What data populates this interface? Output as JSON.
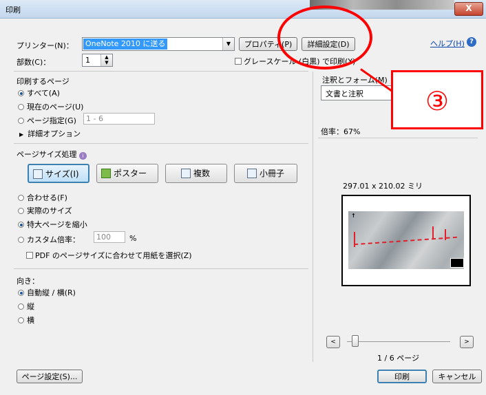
{
  "window": {
    "title": "印刷",
    "close_label": "X"
  },
  "printer": {
    "label": "プリンター(N)：",
    "selected": "OneNote 2010 に送る",
    "properties_button": "プロパティ(P)",
    "advanced_button": "詳細設定(D)",
    "help_link": "ヘルプ(H)"
  },
  "copies": {
    "label": "部数(C)：",
    "value": "1"
  },
  "grayscale": {
    "label": "グレースケール (白黒) で印刷(Y)",
    "checked": false
  },
  "pages_to_print": {
    "heading": "印刷するページ",
    "all": "すべて(A)",
    "current": "現在のページ(U)",
    "range": "ページ指定(G)",
    "range_value": "1 - 6",
    "more_options": "詳細オプション"
  },
  "annotations": {
    "heading": "注釈とフォーム(M)",
    "selected": "文書と注釈"
  },
  "zoom_label": "倍率：67%",
  "page_size_handling": {
    "heading": "ページサイズ処理",
    "buttons": [
      "サイズ(I)",
      "ポスター",
      "複数",
      "小冊子"
    ],
    "fit": "合わせる(F)",
    "actual": "実際のサイズ",
    "shrink": "特大ページを縮小",
    "custom": "カスタム倍率：",
    "custom_value": "100",
    "percent": "%",
    "pdf_paper": "PDF のページサイズに合わせて用紙を選択(Z)"
  },
  "orientation": {
    "heading": "向き：",
    "auto": "自動縦 / 横(R)",
    "portrait": "縦",
    "landscape": "横"
  },
  "preview": {
    "size_text": "297.01 x 210.02 ミリ",
    "page_indicator": "1 / 6 ページ",
    "prev": "<",
    "next": ">"
  },
  "buttons": {
    "page_setup": "ページ設定(S)...",
    "print": "印刷",
    "cancel": "キャンセル"
  },
  "callout": {
    "number": "③"
  },
  "colors": {
    "accent": "#3399ff",
    "annotation_red": "#ff0000"
  }
}
